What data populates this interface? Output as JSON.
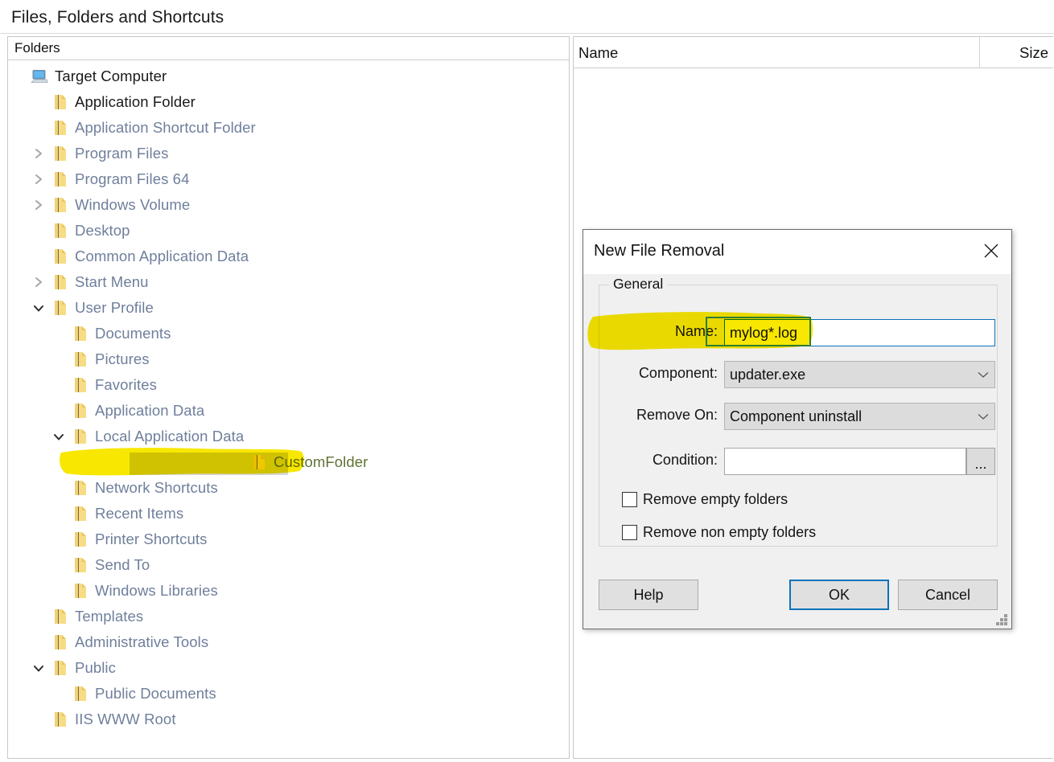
{
  "window": {
    "title": "Files, Folders and Shortcuts"
  },
  "left_panel": {
    "column_header": "Folders",
    "tree": [
      {
        "label": "Target Computer",
        "depth": 0,
        "icon": "computer-icon",
        "expander": "none",
        "style": "dark"
      },
      {
        "label": "Application Folder",
        "depth": 1,
        "icon": "folder-icon",
        "expander": "none",
        "style": "dark"
      },
      {
        "label": "Application Shortcut Folder",
        "depth": 1,
        "icon": "folder-icon",
        "expander": "none",
        "style": "normal"
      },
      {
        "label": "Program Files",
        "depth": 1,
        "icon": "folder-icon",
        "expander": "collapsed",
        "style": "normal"
      },
      {
        "label": "Program Files 64",
        "depth": 1,
        "icon": "folder-icon",
        "expander": "collapsed",
        "style": "normal"
      },
      {
        "label": "Windows Volume",
        "depth": 1,
        "icon": "folder-icon",
        "expander": "collapsed",
        "style": "normal"
      },
      {
        "label": "Desktop",
        "depth": 1,
        "icon": "folder-icon",
        "expander": "none",
        "style": "normal"
      },
      {
        "label": "Common Application Data",
        "depth": 1,
        "icon": "folder-icon",
        "expander": "none",
        "style": "normal"
      },
      {
        "label": "Start Menu",
        "depth": 1,
        "icon": "folder-icon",
        "expander": "collapsed",
        "style": "normal"
      },
      {
        "label": "User Profile",
        "depth": 1,
        "icon": "folder-icon",
        "expander": "expanded",
        "style": "normal"
      },
      {
        "label": "Documents",
        "depth": 2,
        "icon": "folder-icon",
        "expander": "none",
        "style": "normal"
      },
      {
        "label": "Pictures",
        "depth": 2,
        "icon": "folder-icon",
        "expander": "none",
        "style": "normal"
      },
      {
        "label": "Favorites",
        "depth": 2,
        "icon": "folder-icon",
        "expander": "none",
        "style": "normal"
      },
      {
        "label": "Application Data",
        "depth": 2,
        "icon": "folder-icon",
        "expander": "none",
        "style": "normal"
      },
      {
        "label": "Local Application Data",
        "depth": 2,
        "icon": "folder-icon",
        "expander": "expanded",
        "style": "normal"
      },
      {
        "label": "CustomFolder",
        "depth": 3,
        "icon": "folder-icon",
        "expander": "none",
        "style": "selected"
      },
      {
        "label": "Network Shortcuts",
        "depth": 2,
        "icon": "folder-icon",
        "expander": "none",
        "style": "normal"
      },
      {
        "label": "Recent Items",
        "depth": 2,
        "icon": "folder-icon",
        "expander": "none",
        "style": "normal"
      },
      {
        "label": "Printer Shortcuts",
        "depth": 2,
        "icon": "folder-icon",
        "expander": "none",
        "style": "normal"
      },
      {
        "label": "Send To",
        "depth": 2,
        "icon": "folder-icon",
        "expander": "none",
        "style": "normal"
      },
      {
        "label": "Windows Libraries",
        "depth": 2,
        "icon": "folder-icon",
        "expander": "none",
        "style": "normal"
      },
      {
        "label": "Templates",
        "depth": 1,
        "icon": "folder-icon",
        "expander": "none",
        "style": "normal"
      },
      {
        "label": "Administrative Tools",
        "depth": 1,
        "icon": "folder-icon",
        "expander": "none",
        "style": "normal"
      },
      {
        "label": "Public",
        "depth": 1,
        "icon": "folder-icon",
        "expander": "expanded",
        "style": "normal"
      },
      {
        "label": "Public Documents",
        "depth": 2,
        "icon": "folder-icon",
        "expander": "none",
        "style": "normal"
      },
      {
        "label": "IIS WWW Root",
        "depth": 1,
        "icon": "folder-icon",
        "expander": "none",
        "style": "normal"
      }
    ]
  },
  "right_panel": {
    "columns": {
      "name": "Name",
      "size": "Size"
    },
    "rows": []
  },
  "dialog": {
    "title": "New File Removal",
    "close_icon": "close-icon",
    "group_legend": "General",
    "fields": {
      "name_label": "Name:",
      "name_value": "mylog*.log",
      "component_label": "Component:",
      "component_value": "updater.exe",
      "remove_on_label": "Remove On:",
      "remove_on_value": "Component uninstall",
      "condition_label": "Condition:",
      "condition_value": "",
      "condition_browse_label": "..."
    },
    "checkboxes": [
      {
        "label": "Remove empty folders",
        "checked": false
      },
      {
        "label": "Remove non empty folders",
        "checked": false
      }
    ],
    "buttons": {
      "help": "Help",
      "ok": "OK",
      "cancel": "Cancel"
    }
  },
  "annotations": {
    "highlight_color": "#f8e700",
    "box_color": "#2e7d32",
    "marks": [
      {
        "target": "tree-item-customfolder",
        "kind": "highlighter"
      },
      {
        "target": "dialog-name-label",
        "kind": "highlighter"
      },
      {
        "target": "dialog-name-value",
        "kind": "outline-box"
      }
    ]
  }
}
